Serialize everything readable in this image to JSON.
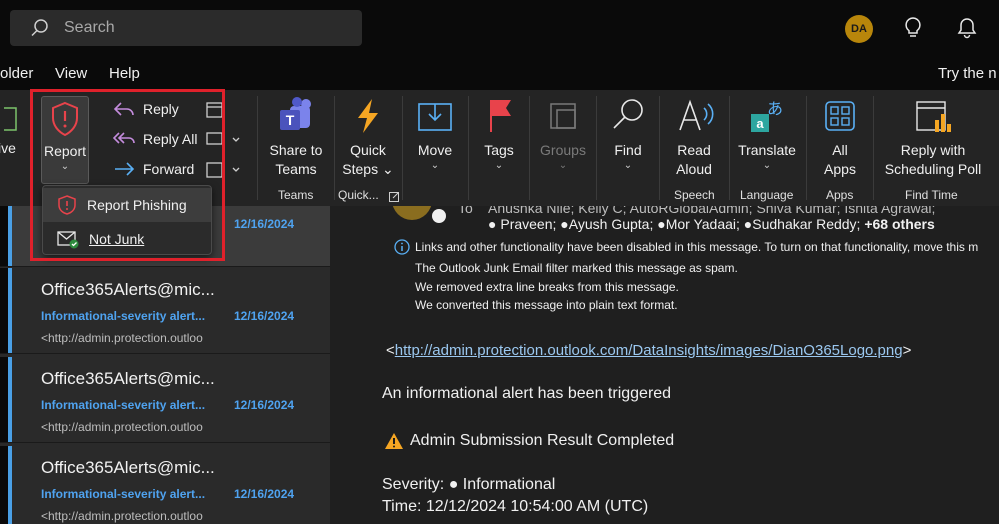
{
  "search": {
    "placeholder": "Search"
  },
  "account": {
    "initials": "DA"
  },
  "menu": {
    "items": [
      "older",
      "View",
      "Help"
    ],
    "tell_me": "Try the n"
  },
  "ribbon": {
    "archive_label": "ive",
    "report": {
      "label": "Report"
    },
    "respond": {
      "reply": "Reply",
      "reply_all": "Reply All",
      "forward": "Forward"
    },
    "teams": {
      "share": "Share to",
      "share2": "Teams",
      "group": "Teams"
    },
    "quicksteps": {
      "label": "Quick",
      "label2": "Steps",
      "group": "Quick..."
    },
    "move": {
      "label": "Move"
    },
    "tags": {
      "label": "Tags"
    },
    "groups": {
      "label": "Groups"
    },
    "find": {
      "label": "Find"
    },
    "speech": {
      "read": "Read",
      "aloud": "Aloud",
      "group": "Speech"
    },
    "language": {
      "label": "Translate",
      "group": "Language"
    },
    "apps": {
      "all": "All",
      "apps": "Apps",
      "group": "Apps"
    },
    "findtime": {
      "reply_with": "Reply with",
      "poll": "Scheduling Poll",
      "group": "Find Time"
    }
  },
  "report_menu": {
    "phishing": "Report Phishing",
    "not_junk": "Not Junk"
  },
  "messages": [
    {
      "from": "",
      "subject": "",
      "date": "12/16/2024",
      "preview": ""
    },
    {
      "from": "Office365Alerts@mic...",
      "subject": "Informational-severity alert...",
      "date": "12/16/2024",
      "preview": "<http://admin.protection.outloo"
    },
    {
      "from": "Office365Alerts@mic...",
      "subject": "Informational-severity alert...",
      "date": "12/16/2024",
      "preview": "<http://admin.protection.outloo"
    },
    {
      "from": "Office365Alerts@mic...",
      "subject": "Informational-severity alert...",
      "date": "12/16/2024",
      "preview": "<http://admin.protection.outloo"
    }
  ],
  "reading": {
    "to_label": "To",
    "recipients_row1": "Anushka Nile; Kelly C; AutoRGlobalAdmin; Shiva Kumar; Ishita Agrawal;",
    "recipients_row2_a": "Praveen;",
    "recipients_row2_b": "Ayush Gupta;",
    "recipients_row2_c": "Mor Yadaai;",
    "recipients_row2_d": "Sudhakar Reddy;",
    "others": "+68 others",
    "info_lines": [
      "Links and other functionality have been disabled in this message. To turn on that functionality, move this m",
      "The Outlook Junk Email filter marked this message as spam.",
      "We removed extra line breaks from this message.",
      "We converted this message into plain text format."
    ],
    "link": "http://admin.protection.outlook.com/DataInsights/images/DianO365Logo.png",
    "link_open": "<",
    "link_close": ">",
    "alert_line": "An informational alert has been triggered",
    "result_line": "Admin Submission Result Completed",
    "severity_line": "Severity: ● Informational",
    "time_line": "Time: 12/12/2024 10:54:00 AM (UTC)"
  },
  "colors": {
    "accent": "#4fa3f0",
    "highlight": "#e0212b",
    "report_red": "#e8434b"
  }
}
